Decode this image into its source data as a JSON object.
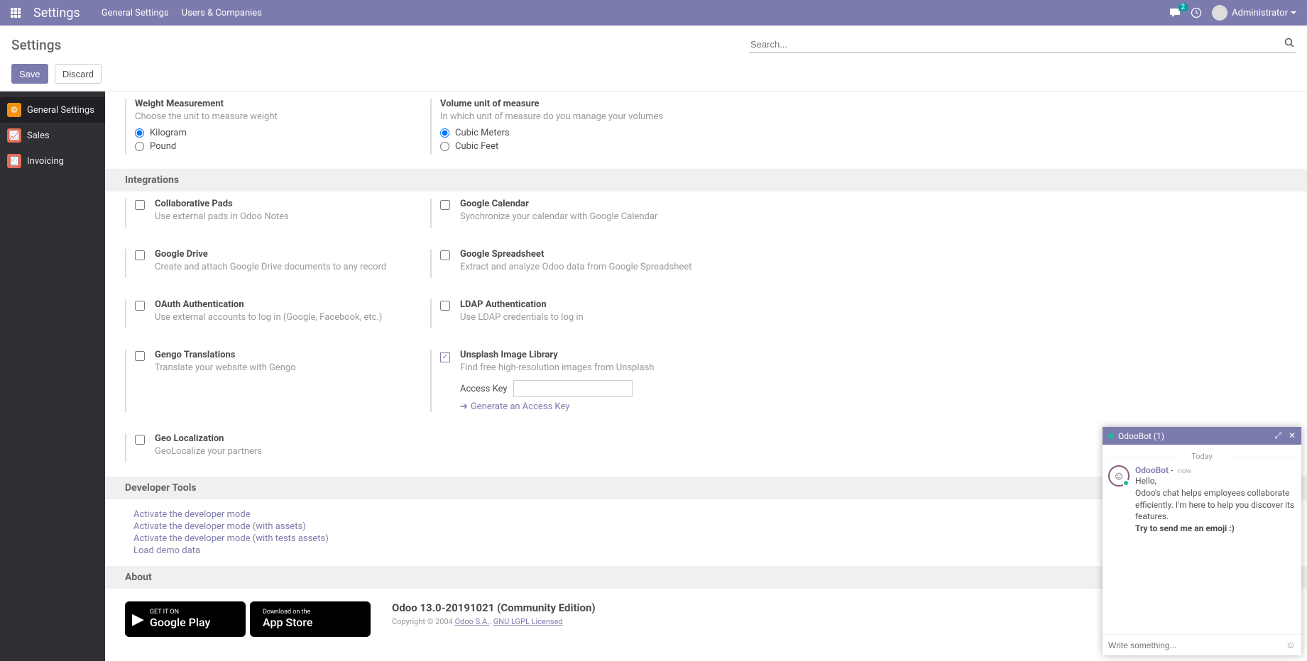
{
  "topbar": {
    "title": "Settings",
    "nav": [
      "General Settings",
      "Users & Companies"
    ],
    "msg_count": "2",
    "user": "Administrator"
  },
  "subheader": {
    "title": "Settings",
    "search_placeholder": "Search..."
  },
  "actions": {
    "save": "Save",
    "discard": "Discard"
  },
  "sidebar": {
    "items": [
      {
        "label": "General Settings",
        "selected": true
      },
      {
        "label": "Sales",
        "selected": false
      },
      {
        "label": "Invoicing",
        "selected": false
      }
    ]
  },
  "measure": {
    "weight": {
      "title": "Weight Measurement",
      "desc": "Choose the unit to measure weight",
      "opt1": "Kilogram",
      "opt2": "Pound"
    },
    "volume": {
      "title": "Volume unit of measure",
      "desc": "In which unit of measure do you manage your volumes",
      "opt1": "Cubic Meters",
      "opt2": "Cubic Feet"
    }
  },
  "sections": {
    "integrations": "Integrations",
    "devtools": "Developer Tools",
    "about": "About"
  },
  "integrations": {
    "pads": {
      "title": "Collaborative Pads",
      "desc": "Use external pads in Odoo Notes"
    },
    "gcal": {
      "title": "Google Calendar",
      "desc": "Synchronize your calendar with Google Calendar"
    },
    "gdrive": {
      "title": "Google Drive",
      "desc": "Create and attach Google Drive documents to any record"
    },
    "gsheet": {
      "title": "Google Spreadsheet",
      "desc": "Extract and analyze Odoo data from Google Spreadsheet"
    },
    "oauth": {
      "title": "OAuth Authentication",
      "desc": "Use external accounts to log in (Google, Facebook, etc.)"
    },
    "ldap": {
      "title": "LDAP Authentication",
      "desc": "Use LDAP credentials to log in"
    },
    "gengo": {
      "title": "Gengo Translations",
      "desc": "Translate your website with Gengo"
    },
    "unsplash": {
      "title": "Unsplash Image Library",
      "desc": "Find free high-resolution images from Unsplash",
      "access_key_label": "Access Key",
      "gen_link": "Generate an Access Key"
    },
    "geo": {
      "title": "Geo Localization",
      "desc": "GeoLocalize your partners"
    }
  },
  "devlinks": {
    "l1": "Activate the developer mode",
    "l2": "Activate the developer mode (with assets)",
    "l3": "Activate the developer mode (with tests assets)",
    "l4": "Load demo data"
  },
  "about": {
    "version": "Odoo 13.0-20191021 (Community Edition)",
    "copyright_prefix": "Copyright © 2004 ",
    "odoo_link": "Odoo S.A.",
    "license_link": "GNU LGPL Licensed",
    "gplay_small": "GET IT ON",
    "gplay_big": "Google Play",
    "appstore_small": "Download on the",
    "appstore_big": "App Store"
  },
  "chat": {
    "title": "OdooBot (1)",
    "date": "Today",
    "from": "OdooBot",
    "time": "now",
    "line1": "Hello,",
    "line2": "Odoo's chat helps employees collaborate efficiently. I'm here to help you discover its features.",
    "line3": "Try to send me an emoji :)",
    "input_placeholder": "Write something..."
  }
}
